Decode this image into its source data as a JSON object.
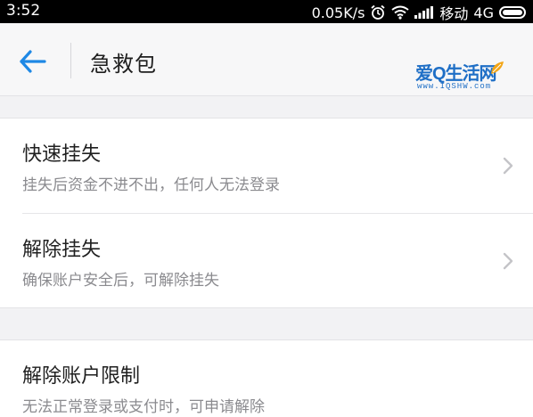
{
  "status_bar": {
    "time": "3:52",
    "speed": "0.05K/s",
    "carrier": "移动",
    "network": "4G",
    "icons": [
      "alarm-icon",
      "wifi-icon",
      "signal-icon",
      "battery-icon"
    ]
  },
  "nav": {
    "back_icon": "back-arrow-icon",
    "title": "急救包",
    "accent_color": "#1e88e5"
  },
  "watermark": {
    "main": "爱Q生活网",
    "sub": "www.IQSHW.com"
  },
  "items": [
    {
      "title": "快速挂失",
      "desc": "挂失后资金不进不出，任何人无法登录",
      "chevron": true
    },
    {
      "title": "解除挂失",
      "desc": "确保账户安全后，可解除挂失",
      "chevron": true
    },
    {
      "title": "解除账户限制",
      "desc": "无法正常登录或支付时，可申请解除",
      "chevron": false
    }
  ]
}
